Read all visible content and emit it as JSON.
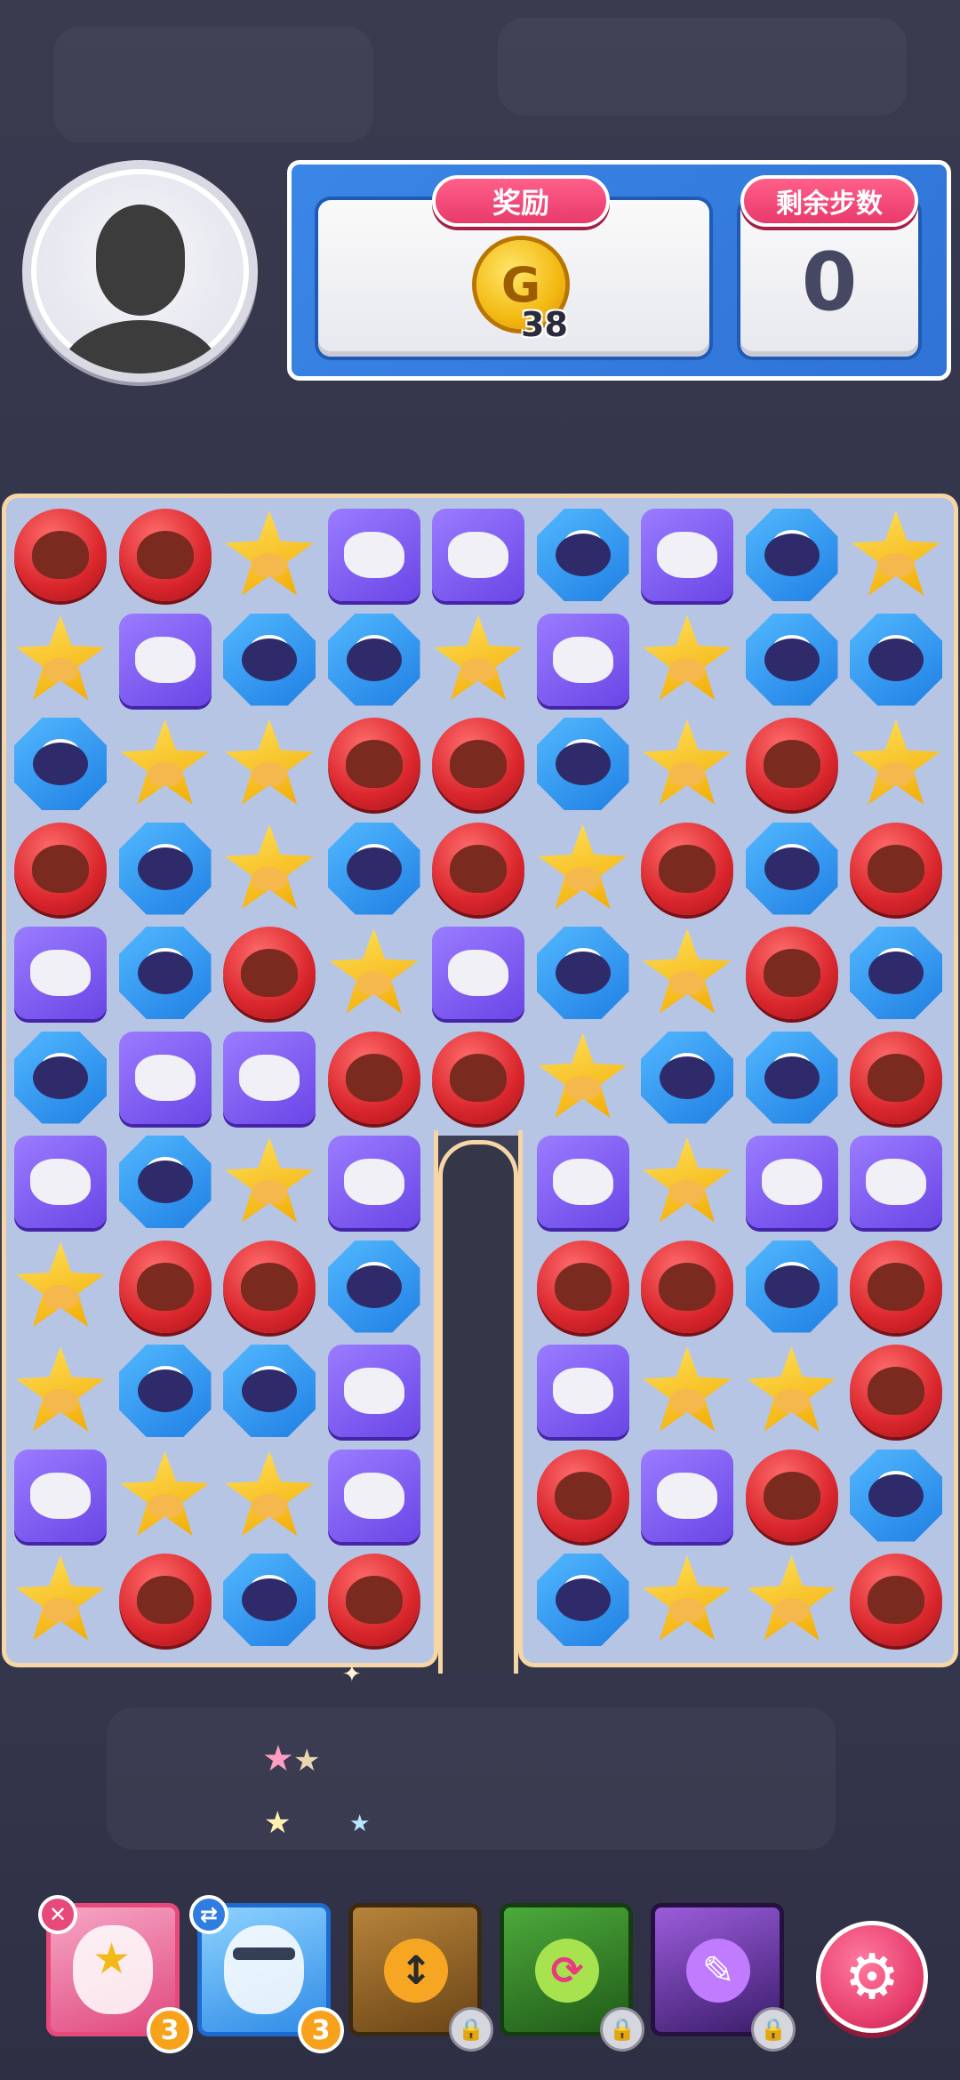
{
  "colors": {
    "red": "#d9262c",
    "purple": "#6a45e6",
    "blue": "#1f7fe3",
    "yellow": "#f1a800",
    "accent": "#e73c6c",
    "panel": "#2f73d6"
  },
  "header": {
    "avatar_icon": "default-avatar-icon",
    "reward_label": "奖励",
    "reward_icon": "gold-coin-icon",
    "coin_letter": "G",
    "reward_amount": "38",
    "moves_label": "剩余步数",
    "moves_value": "0"
  },
  "board": {
    "columns": 9,
    "rows": 11,
    "hole": {
      "columns": [
        4
      ],
      "from_row": 6
    },
    "tiles": [
      [
        "red",
        "red",
        "yellow",
        "purple",
        "purple",
        "blue",
        "purple",
        "blue",
        "yellow"
      ],
      [
        "yellow",
        "purple",
        "blue",
        "blue",
        "yellow",
        "purple",
        "yellow",
        "blue",
        "blue"
      ],
      [
        "blue",
        "yellow",
        "yellow",
        "red",
        "red",
        "blue",
        "yellow",
        "red",
        "yellow"
      ],
      [
        "red",
        "blue",
        "yellow",
        "blue",
        "red",
        "yellow",
        "red",
        "blue",
        "red"
      ],
      [
        "purple",
        "blue",
        "red",
        "yellow",
        "purple",
        "blue",
        "yellow",
        "red",
        "blue"
      ],
      [
        "blue",
        "purple",
        "purple",
        "red",
        "red",
        "yellow",
        "blue",
        "blue",
        "red"
      ],
      [
        "purple",
        "blue",
        "yellow",
        "purple",
        null,
        "purple",
        "yellow",
        "purple",
        "purple"
      ],
      [
        "yellow",
        "red",
        "red",
        "blue",
        null,
        "red",
        "red",
        "blue",
        "red"
      ],
      [
        "yellow",
        "blue",
        "blue",
        "purple",
        null,
        "purple",
        "yellow",
        "yellow",
        "red"
      ],
      [
        "purple",
        "yellow",
        "yellow",
        "purple",
        null,
        "red",
        "purple",
        "red",
        "blue"
      ],
      [
        "yellow",
        "red",
        "blue",
        "red",
        null,
        "blue",
        "yellow",
        "yellow",
        "red"
      ]
    ]
  },
  "toolbar": {
    "cards": [
      {
        "name": "character-card-star",
        "badge": "3",
        "corner_icon": "close-icon",
        "corner_symbol": "✕"
      },
      {
        "name": "character-card-swap",
        "badge": "3",
        "corner_icon": "swap-icon",
        "corner_symbol": "⇄"
      },
      {
        "name": "booster-vertical-arrow",
        "icon": "vertical-arrows-icon",
        "symbol": "↕",
        "locked": true,
        "lock_symbol": "🔒"
      },
      {
        "name": "booster-shuffle",
        "icon": "shuffle-icon",
        "symbol": "⟳",
        "locked": true,
        "lock_symbol": "🔒"
      },
      {
        "name": "booster-drop",
        "icon": "drop-icon",
        "symbol": "✎",
        "locked": true,
        "lock_symbol": "🔒"
      }
    ],
    "settings_icon": "gear-icon",
    "settings_symbol": "⚙"
  }
}
